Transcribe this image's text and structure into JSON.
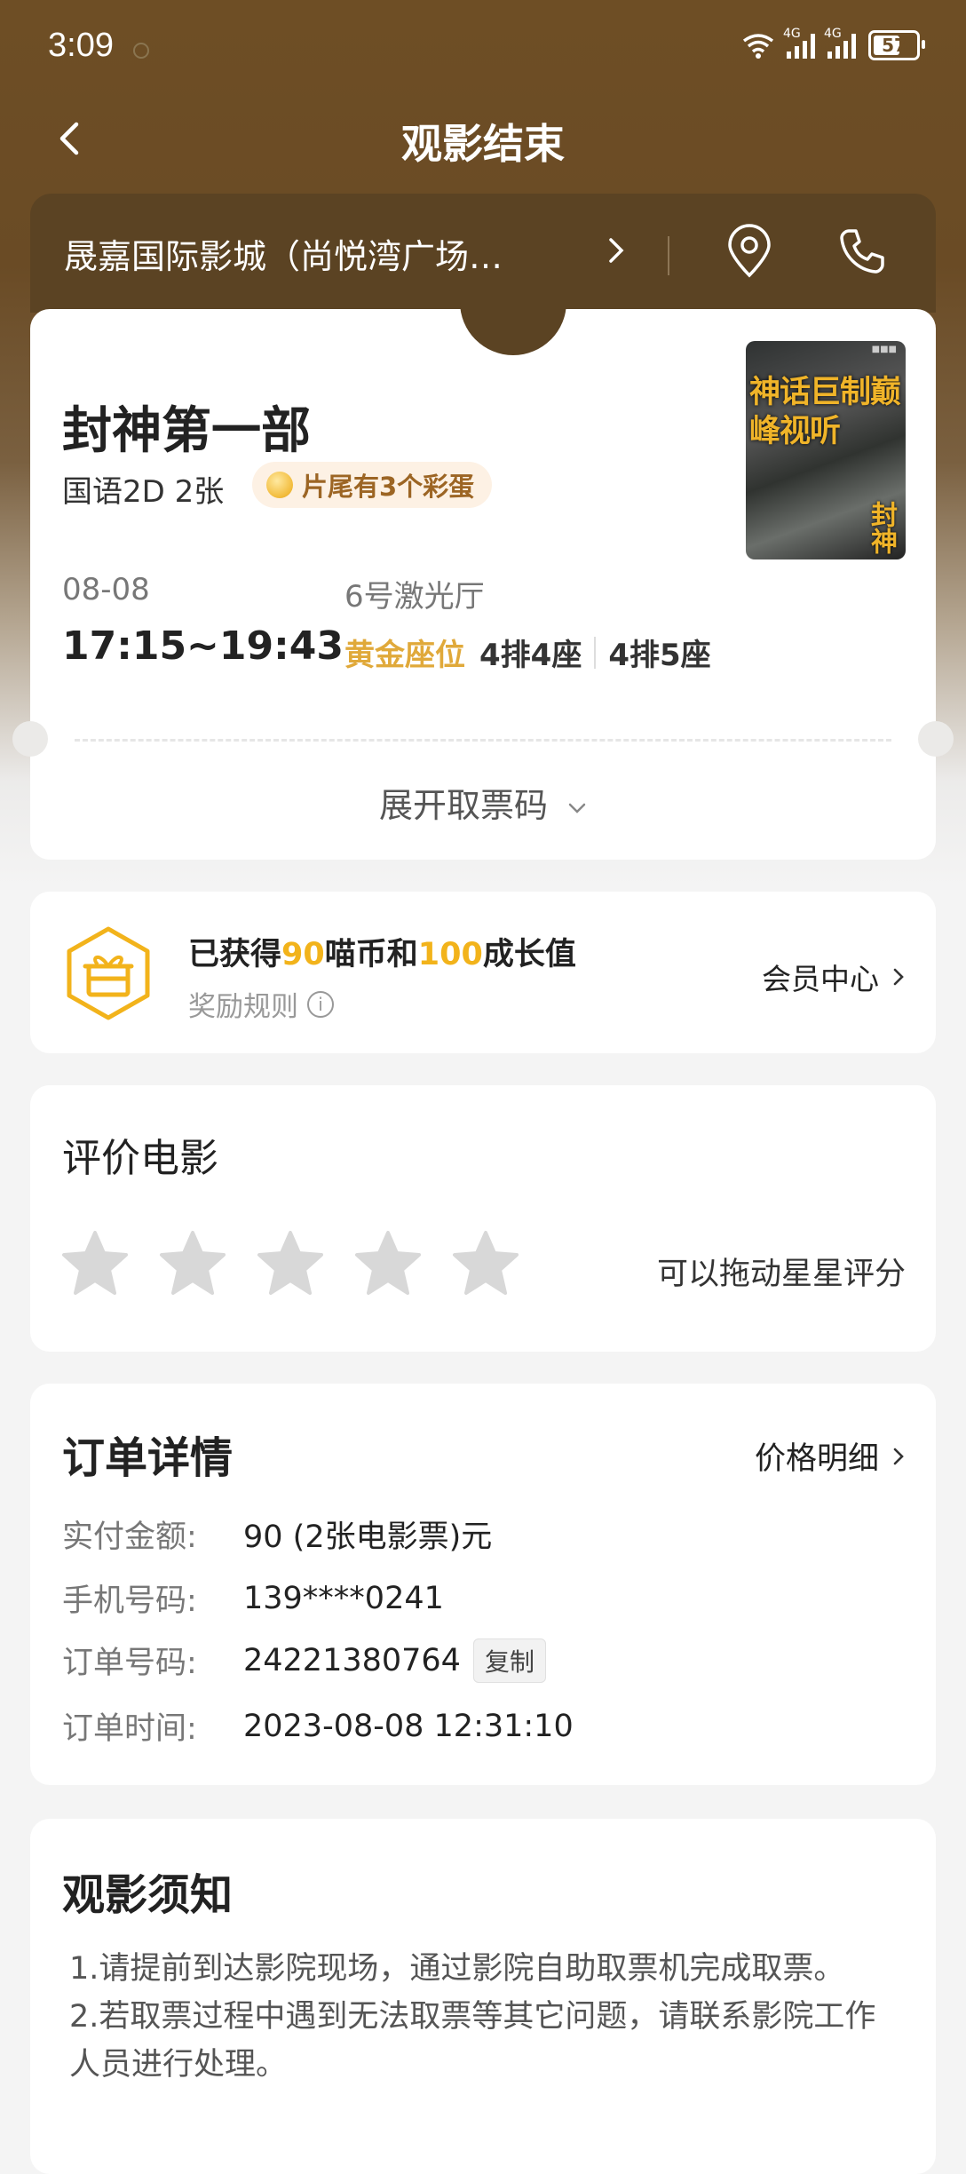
{
  "status_bar": {
    "time": "3:09",
    "battery": "57",
    "net1": "4G",
    "net2": "4G"
  },
  "header": {
    "title": "观影结束"
  },
  "cinema": {
    "name": "晟嘉国际影城（尚悦湾广场…"
  },
  "ticket": {
    "movie_title": "封神第一部",
    "language_format": "国语2D 2张",
    "easter_egg": "片尾有3个彩蛋",
    "poster_text": "神话巨制巅峰视听",
    "poster_logo": "封神",
    "date": "08-08",
    "time": "17:15~19:43",
    "hall": "6号激光厅",
    "seat_type": "黄金座位",
    "seats": [
      "4排4座",
      "4排5座"
    ],
    "expand_label": "展开取票码"
  },
  "reward": {
    "prefix": "已获得",
    "coins": "90",
    "mid": "喵币和",
    "growth": "100",
    "suffix": "成长值",
    "rule_label": "奖励规则",
    "member_link": "会员中心"
  },
  "rating": {
    "title": "评价电影",
    "stars_total": 5,
    "stars_selected": 0,
    "hint": "可以拖动星星评分"
  },
  "order": {
    "title": "订单详情",
    "price_link": "价格明细",
    "rows": [
      {
        "label": "实付金额:",
        "value": "90 (2张电影票)元"
      },
      {
        "label": "手机号码:",
        "value": "139****0241"
      },
      {
        "label": "订单号码:",
        "value": "24221380764"
      },
      {
        "label": "订单时间:",
        "value": "2023-08-08 12:31:10"
      }
    ],
    "copy_label": "复制"
  },
  "notice": {
    "title": "观影须知",
    "items": [
      "1.请提前到达影院现场，通过影院自助取票机完成取票。",
      "2.若取票过程中遇到无法取票等其它问题，请联系影院工作人员进行处理。"
    ]
  },
  "colors": {
    "header_brown": "#6e4e25",
    "accent_gold": "#f2b31b",
    "seat_gold": "#e0a93a"
  }
}
